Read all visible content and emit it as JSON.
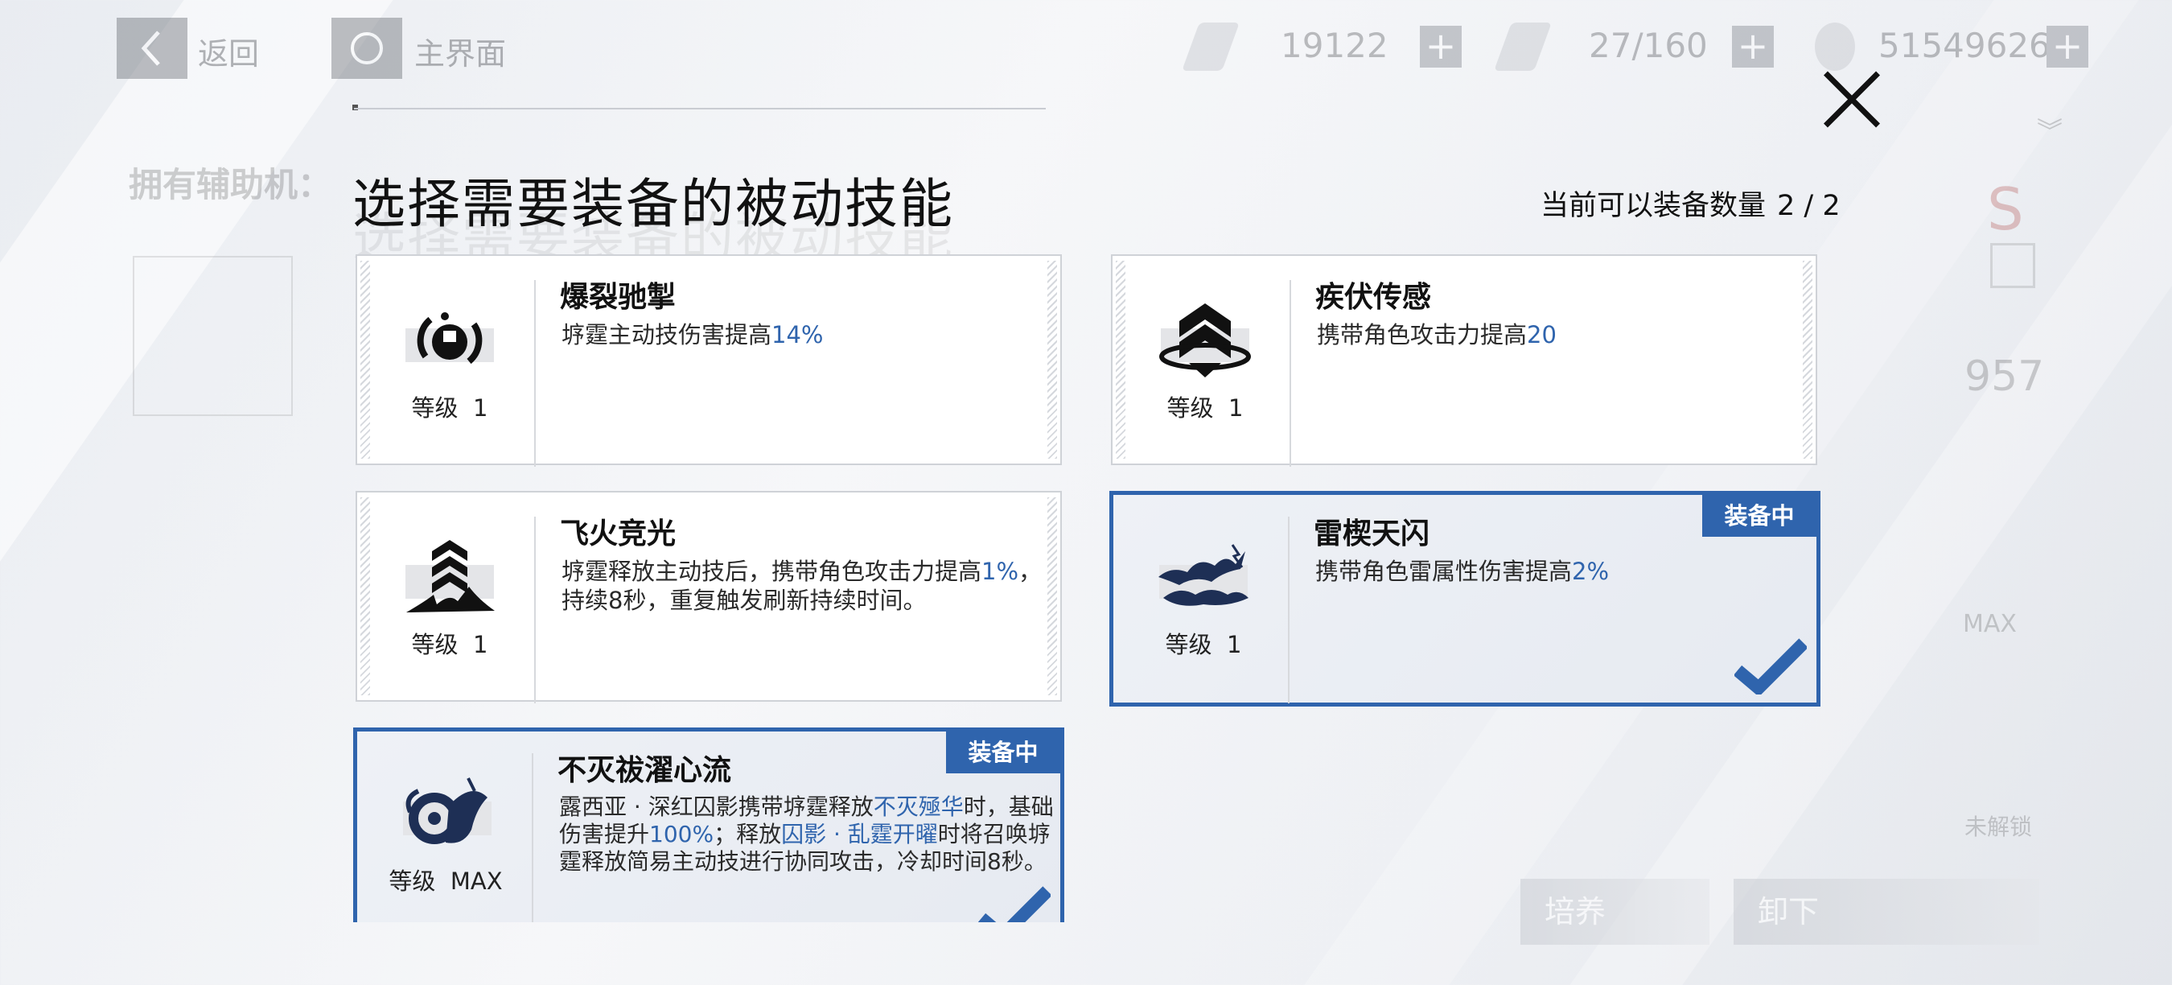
{
  "topbar": {
    "back_label": "返回",
    "home_label": "主界面",
    "resources": [
      {
        "icon": "ticket-icon",
        "value": "19122"
      },
      {
        "icon": "fuel-icon",
        "value": "27/160"
      },
      {
        "icon": "coin-icon",
        "value": "51549626"
      }
    ]
  },
  "background": {
    "owned_label": "拥有辅助机：",
    "rank": "S",
    "power": "957",
    "max_label": "MAX",
    "locked_label": "未解锁",
    "train_label": "培养",
    "unequip_label": "卸下"
  },
  "modal": {
    "title": "选择需要装备的被动技能",
    "count_label": "当前可以装备数量",
    "count_value": "2 / 2",
    "equipped_badge": "装备中",
    "level_prefix": "等级"
  },
  "skills": [
    {
      "name": "爆裂驰掣",
      "level": "1",
      "equipped": false,
      "icon": "burst-skill-icon",
      "desc": [
        [
          "垿霆主动技伤害提高",
          false
        ],
        [
          "14%",
          true
        ]
      ]
    },
    {
      "name": "疾伏传感",
      "level": "1",
      "equipped": false,
      "icon": "rank-chevron-skill-icon",
      "desc": [
        [
          "携带角色攻击力提高",
          false
        ],
        [
          "20",
          true
        ]
      ]
    },
    {
      "name": "飞火竞光",
      "level": "1",
      "equipped": false,
      "icon": "flame-chevron-skill-icon",
      "desc": [
        [
          "垿霆释放主动技后，携带角色攻击力提高",
          false
        ],
        [
          "1%",
          true
        ],
        [
          "，持续8秒，重复触发刷新持续时间。",
          false
        ]
      ]
    },
    {
      "name": "雷楔天闪",
      "level": "1",
      "equipped": true,
      "icon": "thunder-cloud-skill-icon",
      "desc": [
        [
          "携带角色雷属性伤害提高",
          false
        ],
        [
          "2%",
          true
        ]
      ]
    },
    {
      "name": "不灭祓濯心流",
      "level": "MAX",
      "equipped": true,
      "icon": "serpent-skill-icon",
      "desc": [
        [
          "露西亚 · 深红囚影携带垿霆释放",
          false
        ],
        [
          "不灭殛华",
          true
        ],
        [
          "时，基础伤害提升",
          false
        ],
        [
          "100%",
          true
        ],
        [
          "；释放",
          false
        ],
        [
          "囚影 · 乱霆开曜",
          true
        ],
        [
          "时将召唤垿霆释放简易主动技进行协同攻击，冷却时间8秒。",
          false
        ]
      ]
    }
  ]
}
